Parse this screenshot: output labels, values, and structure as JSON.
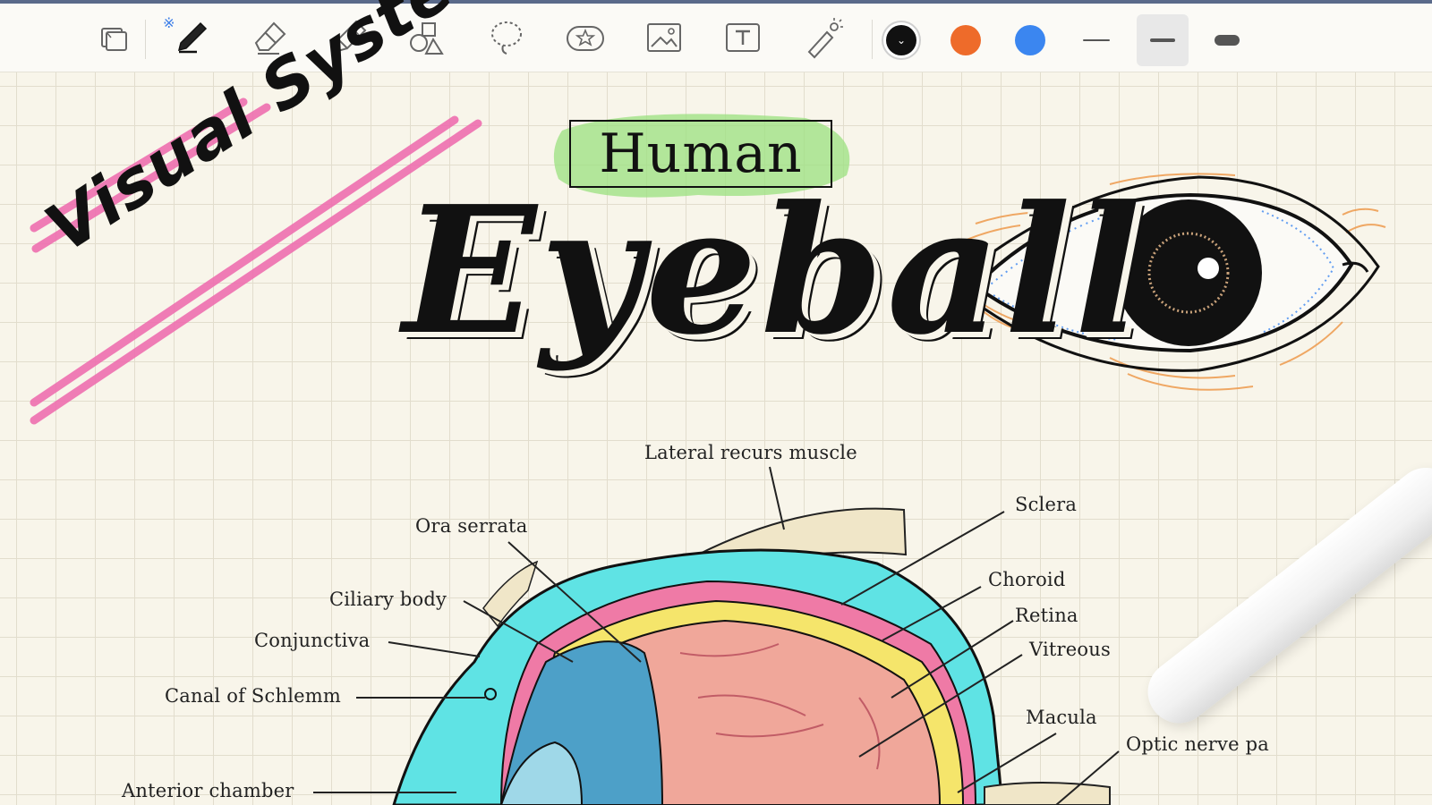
{
  "toolbar": {
    "tools": [
      {
        "name": "page-layout-tool",
        "icon": "pages-icon"
      },
      {
        "name": "pen-tool",
        "icon": "pen-icon"
      },
      {
        "name": "eraser-tool",
        "icon": "eraser-icon"
      },
      {
        "name": "highlighter-tool",
        "icon": "highlighter-icon"
      },
      {
        "name": "shapes-tool",
        "icon": "shapes-icon"
      },
      {
        "name": "lasso-tool",
        "icon": "lasso-icon"
      },
      {
        "name": "sticker-tool",
        "icon": "sticker-icon"
      },
      {
        "name": "image-tool",
        "icon": "image-icon"
      },
      {
        "name": "text-tool",
        "icon": "text-icon"
      },
      {
        "name": "laser-pointer-tool",
        "icon": "laser-pointer-icon"
      }
    ],
    "active_tool": "pen-tool",
    "bluetooth_icon": "bluetooth-icon",
    "colors": [
      "#111111",
      "#ee6b2a",
      "#3b86f0"
    ],
    "selected_color": "#111111",
    "thickness_options": [
      "thin",
      "medium",
      "thick"
    ],
    "selected_thickness": "medium"
  },
  "note": {
    "decor_title": "Visual System",
    "boxed_word": "Human",
    "main_title": "Eyeball",
    "highlight_colors": {
      "pink": "#ef6fb0",
      "green": "#9be07f"
    }
  },
  "labels": {
    "lateral": "Lateral recurs muscle",
    "sclera": "Sclera",
    "ora_serrata": "Ora serrata",
    "choroid": "Choroid",
    "ciliary_body": "Ciliary body",
    "retina": "Retina",
    "conjunctiva": "Conjunctiva",
    "vitreous": "Vitreous",
    "canal": "Canal of Schlemm",
    "macula": "Macula",
    "optic_nerve": "Optic nerve pa",
    "anterior_chamber": "Anterior chamber"
  }
}
